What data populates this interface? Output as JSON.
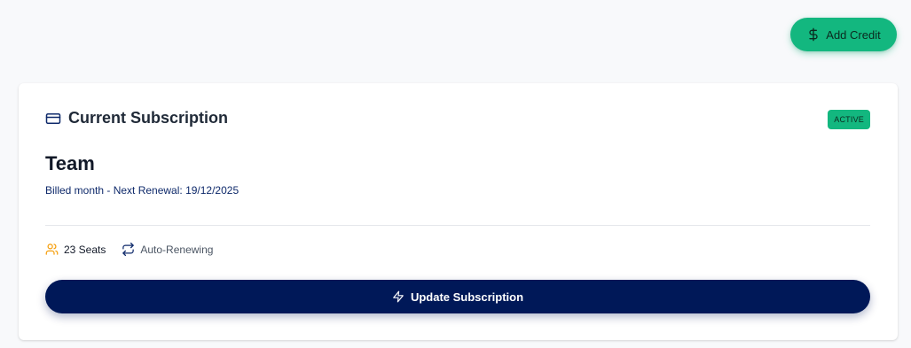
{
  "header": {
    "add_credit_label": "Add Credit",
    "add_credit_icon": "dollar-icon"
  },
  "subscription": {
    "section_title": "Current Subscription",
    "section_icon": "credit-card-icon",
    "status": "ACTIVE",
    "plan_name": "Team",
    "billing_info": "Billed month - Next Renewal: 19/12/2025",
    "seats": {
      "icon": "users-icon",
      "label": "23 Seats"
    },
    "renewal": {
      "icon": "repeat-icon",
      "label": "Auto-Renewing"
    },
    "update_button": {
      "icon": "lightning-icon",
      "label": "Update Subscription"
    }
  },
  "colors": {
    "accent_green": "#13b77f",
    "primary_navy": "#001858",
    "seats_icon_orange": "#f59e0b",
    "background": "#f8f9fb"
  }
}
